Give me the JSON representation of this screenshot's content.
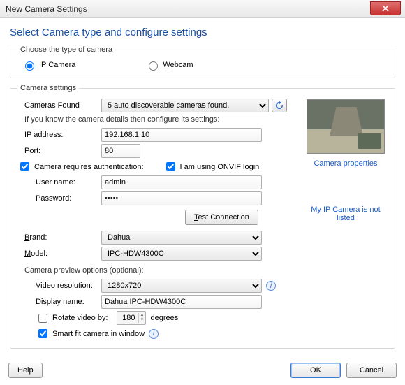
{
  "window": {
    "title": "New Camera Settings"
  },
  "heading": "Select Camera type and configure settings",
  "groupType": {
    "legend": "Choose the type of camera",
    "ipcamera": "IP Camera",
    "webcam": "Webcam"
  },
  "settings": {
    "legend": "Camera settings",
    "camerasFoundLabel": "Cameras Found",
    "camerasFoundValue": "5 auto discoverable cameras found.",
    "note": "If you know the camera details then configure its settings:",
    "ipLabel": "IP address:",
    "ipValue": "192.168.1.10",
    "portLabel": "Port:",
    "portValue": "80",
    "authLabel": "Camera requires authentication:",
    "onvifLabel": "I am using ONVIF login",
    "userLabel": "User name:",
    "userValue": "admin",
    "passLabel": "Password:",
    "passValue": "•••••",
    "testBtn": "Test Connection",
    "brandLabel": "Brand:",
    "brandValue": "Dahua",
    "modelLabel": "Model:",
    "modelValue": "IPC-HDW4300C",
    "previewOptions": "Camera preview options (optional):",
    "resLabel": "Video resolution:",
    "resValue": "1280x720",
    "dispLabel": "Display name:",
    "dispValue": "Dahua IPC-HDW4300C",
    "rotateLabel": "Rotate video by:",
    "rotateValue": "180",
    "rotateSuffix": "degrees",
    "smartFitLabel": "Smart fit camera in window",
    "camPropsLink": "Camera properties",
    "notListedLink": "My IP Camera is not listed"
  },
  "footer": {
    "help": "Help",
    "ok": "OK",
    "cancel": "Cancel"
  }
}
